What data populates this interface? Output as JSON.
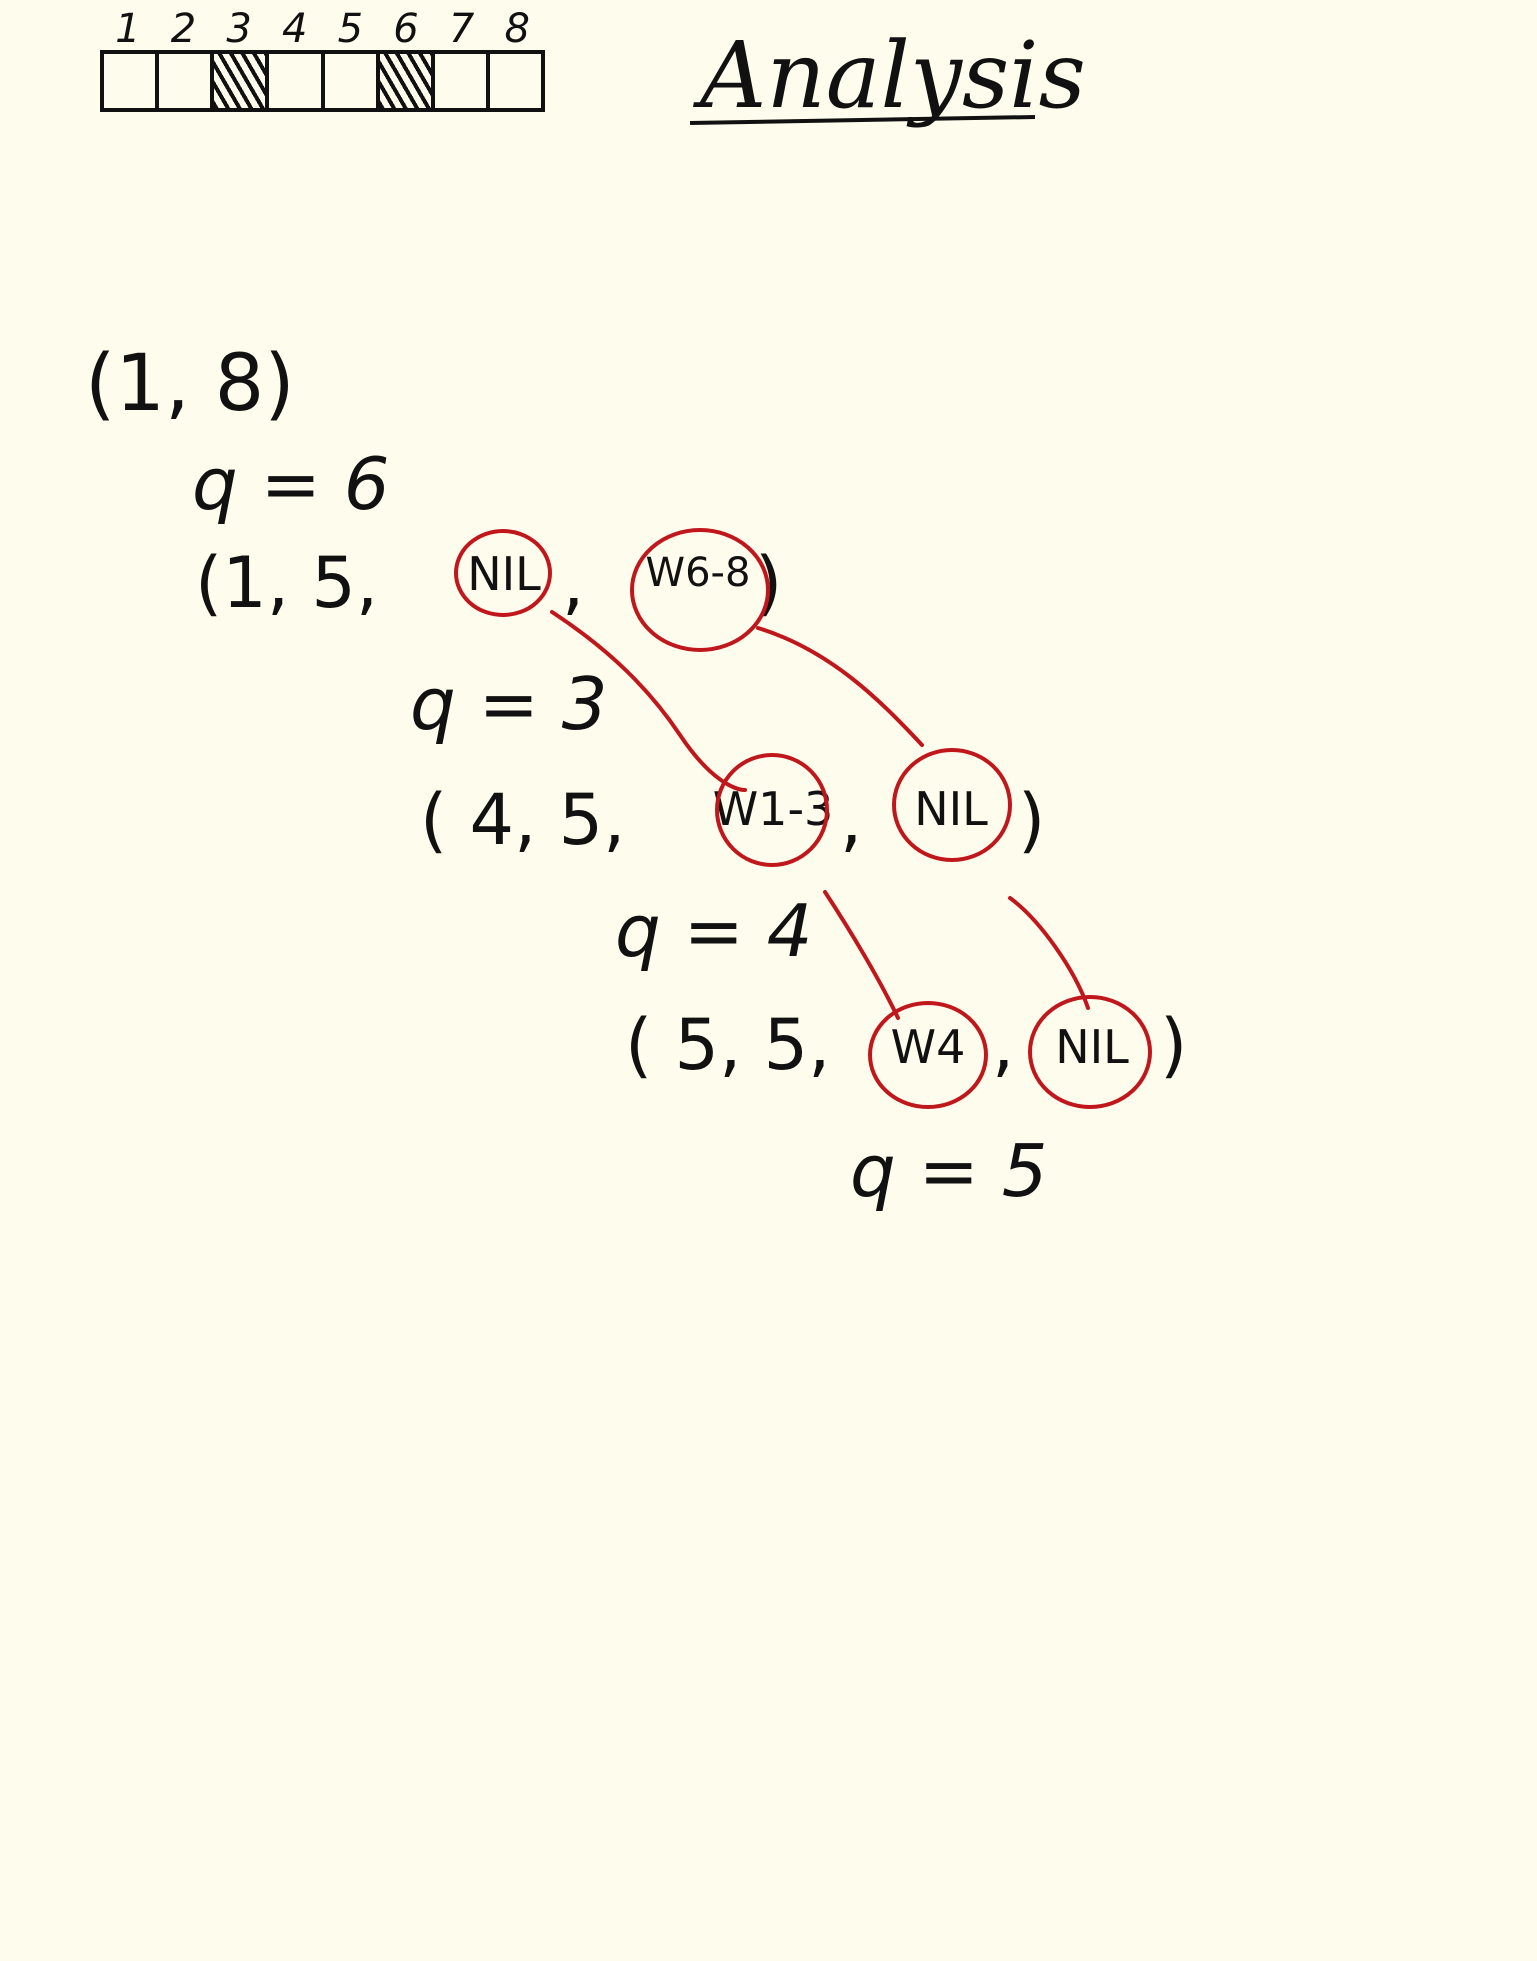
{
  "header": {
    "indices": [
      "1",
      "2",
      "3",
      "4",
      "5",
      "6",
      "7",
      "8"
    ],
    "shaded_cells": [
      3,
      6
    ],
    "title": "Analysis"
  },
  "trace": {
    "call_0": "(1, 8)",
    "q_0": "q = 6",
    "call_1_prefix": "(1, 5,",
    "call_1_arg1": "NIL",
    "call_1_arg2": "W6-8",
    "call_1_suffix": ")",
    "q_1": "q = 3",
    "call_2_prefix": "( 4, 5,",
    "call_2_arg1": "W1-3",
    "call_2_arg2": "NIL",
    "call_2_suffix": ")",
    "q_2": "q = 4",
    "call_3_prefix": "( 5, 5,",
    "call_3_arg1": "W4",
    "call_3_arg2": "NIL",
    "call_3_suffix": ")",
    "q_3": "q = 5"
  },
  "colors": {
    "ink": "#111111",
    "annotation": "#c0171c",
    "paper": "#fefcec"
  }
}
